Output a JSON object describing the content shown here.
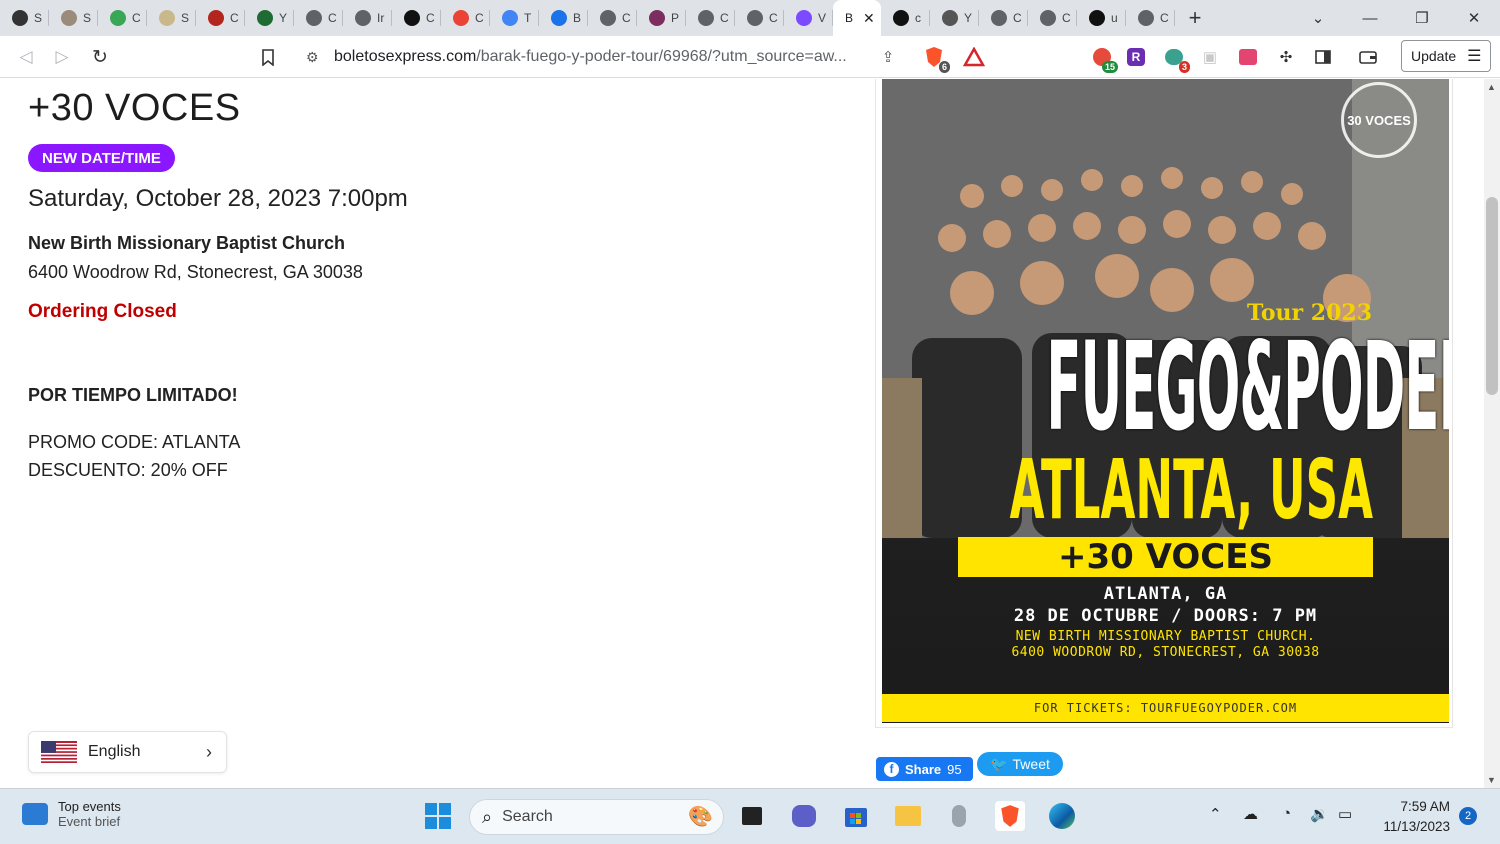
{
  "browser": {
    "tabs": [
      {
        "letter": "S",
        "icon": "soccer-ball-icon",
        "color": "#333333"
      },
      {
        "letter": "S",
        "icon": "photo-icon",
        "color": "#9b8b7a"
      },
      {
        "letter": "C",
        "icon": "green-doc-icon",
        "color": "#3aa757"
      },
      {
        "letter": "S",
        "icon": "ball-icon",
        "color": "#c9b98a"
      },
      {
        "letter": "C",
        "icon": "shield-icon",
        "color": "#b3261e"
      },
      {
        "letter": "Y",
        "icon": "leaf-icon",
        "color": "#1e6b34"
      },
      {
        "letter": "C",
        "icon": "globe-icon",
        "color": "#5f6368"
      },
      {
        "letter": "Ir",
        "icon": "globe-icon",
        "color": "#5f6368"
      },
      {
        "letter": "C",
        "icon": "mustache-icon",
        "color": "#111111"
      },
      {
        "letter": "C",
        "icon": "gmail-icon",
        "color": "#ea4335"
      },
      {
        "letter": "T",
        "icon": "translate-icon",
        "color": "#4285f4"
      },
      {
        "letter": "B",
        "icon": "m-logo-icon",
        "color": "#1a73e8"
      },
      {
        "letter": "C",
        "icon": "globe-icon",
        "color": "#5f6368"
      },
      {
        "letter": "P",
        "icon": "figure-icon",
        "color": "#7b2d5d"
      },
      {
        "letter": "C",
        "icon": "globe-icon",
        "color": "#5f6368"
      },
      {
        "letter": "C",
        "icon": "globe-icon",
        "color": "#5f6368"
      },
      {
        "letter": "V",
        "icon": "chat-icon",
        "color": "#7b4bff"
      }
    ],
    "active_tab": {
      "letter": "B",
      "close": "✕"
    },
    "tabs_right": [
      {
        "letter": "c",
        "icon": "s-logo-icon",
        "color": "#111111"
      },
      {
        "letter": "Y",
        "icon": "ring-icon",
        "color": "#555555"
      },
      {
        "letter": "C",
        "icon": "globe-icon",
        "color": "#5f6368"
      },
      {
        "letter": "C",
        "icon": "globe-icon",
        "color": "#5f6368"
      },
      {
        "letter": "u",
        "icon": "s-logo-icon",
        "color": "#111111"
      },
      {
        "letter": "C",
        "icon": "globe-icon",
        "color": "#5f6368"
      }
    ],
    "url_domain": "boletosexpress.com",
    "url_path": "/barak-fuego-y-poder-tour/69968/?utm_source=aw...",
    "update_label": "Update",
    "ext_badges": {
      "brave": "6",
      "ext1": "15",
      "ext3": "3"
    }
  },
  "event": {
    "title": "+30 VOCES",
    "badge": "NEW DATE/TIME",
    "datetime": "Saturday, October 28, 2023 7:00pm",
    "venue": "New Birth Missionary Baptist Church",
    "address": "6400 Woodrow Rd, Stonecrest, GA 30038",
    "status": "Ordering Closed",
    "promo_heading": "POR TIEMPO LIMITADO!",
    "promo_code": "PROMO CODE: ATLANTA",
    "discount": "DESCUENTO: 20% OFF"
  },
  "language": {
    "label": "English"
  },
  "poster": {
    "logo_text": "30 VOCES",
    "tour": "Tour 2023",
    "headline": "FUEGO&PODER",
    "city": "ATLANTA, USA",
    "band": "+30 VOCES",
    "line1": "ATLANTA, GA",
    "line2": "28 DE OCTUBRE / DOORS: 7 PM",
    "line3": "NEW BIRTH MISSIONARY BAPTIST CHURCH.",
    "line4": "6400 WOODROW RD, STONECREST, GA 30038",
    "footer": "FOR TICKETS: TOURFUEGOYPODER.COM"
  },
  "social": {
    "share_label": "Share",
    "share_count": "95",
    "tweet_label": "Tweet"
  },
  "taskbar": {
    "widget_title": "Top events",
    "widget_sub": "Event brief",
    "search_placeholder": "Search",
    "time": "7:59 AM",
    "date": "11/13/2023",
    "notifications": "2"
  }
}
